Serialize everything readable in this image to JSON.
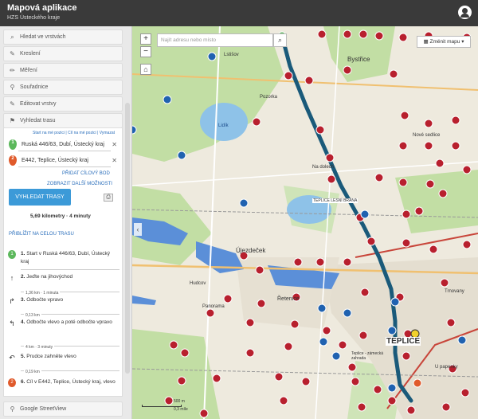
{
  "header": {
    "title": "Mapová aplikace",
    "subtitle": "HZS Ústeckého kraje"
  },
  "sidebar": {
    "panels": [
      {
        "icon": "search-icon",
        "glyph": "🔍",
        "label": "Hledat ve vrstvách"
      },
      {
        "icon": "brush-icon",
        "glyph": "✎",
        "label": "Kreslení"
      },
      {
        "icon": "ruler-icon",
        "glyph": "✏",
        "label": "Měření"
      },
      {
        "icon": "pin-icon",
        "glyph": "⚲",
        "label": "Souřadnice"
      },
      {
        "icon": "pencil-icon",
        "glyph": "✎",
        "label": "Editovat vrstvy"
      },
      {
        "icon": "route-icon",
        "glyph": "⚑",
        "label": "Vyhledat trasu"
      }
    ],
    "bottom_panel": {
      "icon": "pegman-icon",
      "label": "Google StreetView"
    },
    "route": {
      "links_text": "Start na mé pozici | Cíl na mé pozici | Vymazat",
      "start": "Ruská 446/63, Dubí, Ústecký kraj",
      "end": "E442, Teplice, Ústecký kraj",
      "start_marker": "1",
      "end_marker": "2",
      "add_target": "PŘIDAT CÍLOVÝ BOD",
      "show_options": "ZOBRAZIT DALŠÍ MOŽNOSTI",
      "search_button": "VYHLEDAT TRASY",
      "summary": "5,69 kilometry · 4 minuty",
      "zoom_route": "PŘIBLÍŽIT NA CELOU TRASU",
      "steps": [
        {
          "marker": "1",
          "text_num": "1.",
          "text": "Start v Ruská 446/63, Dubí, Ústecký kraj",
          "dist": ""
        },
        {
          "marker": "↑",
          "text_num": "2.",
          "text": "Jeďte na jihovýchod",
          "dist": "1,36 km · 1 minuta"
        },
        {
          "marker": "↱",
          "text_num": "3.",
          "text": "Odbočte vpravo",
          "dist": "0,13 km"
        },
        {
          "marker": "↰",
          "text_num": "4.",
          "text": "Odbočte vlevo a poté odbočte vpravo",
          "dist": "4 km · 3 minuty"
        },
        {
          "marker": "↶",
          "text_num": "5.",
          "text": "Prudce zahněte vlevo",
          "dist": "0,19 km"
        },
        {
          "marker": "2",
          "text_num": "6.",
          "text": "Cíl v E442, Teplice, Ústecký kraj, vlevo",
          "dist": ""
        }
      ]
    }
  },
  "map": {
    "search_placeholder": "Najít adresu nebo místo",
    "change_map": "Změnit mapu",
    "labels": {
      "bystrice": "Bystřice",
      "pozorka": "Pozorka",
      "usedecek": "Újezdeček",
      "teplice": "TEPLICE",
      "retenice": "Řetenice",
      "lidik": "Lidík",
      "na_dolech": "Na dolech",
      "teplice_lesni_brana": "TEPLICE LESNÍ BRÁNA",
      "panorama": "Panorama",
      "hudcov": "Hudcov",
      "lstisov": "Lstišov",
      "nove_sedlice": "Nové sedlice",
      "trnovany": "Trnovany",
      "u_papenky": "U papenky",
      "teplice_zamek": "Teplice - zámecká zahrada"
    },
    "scale_top": "500 m",
    "scale_bottom": "0,3 míle",
    "colors": {
      "route": "#1a5a7a",
      "water": "#5b8fd8",
      "forest": "#b8d89a"
    }
  }
}
